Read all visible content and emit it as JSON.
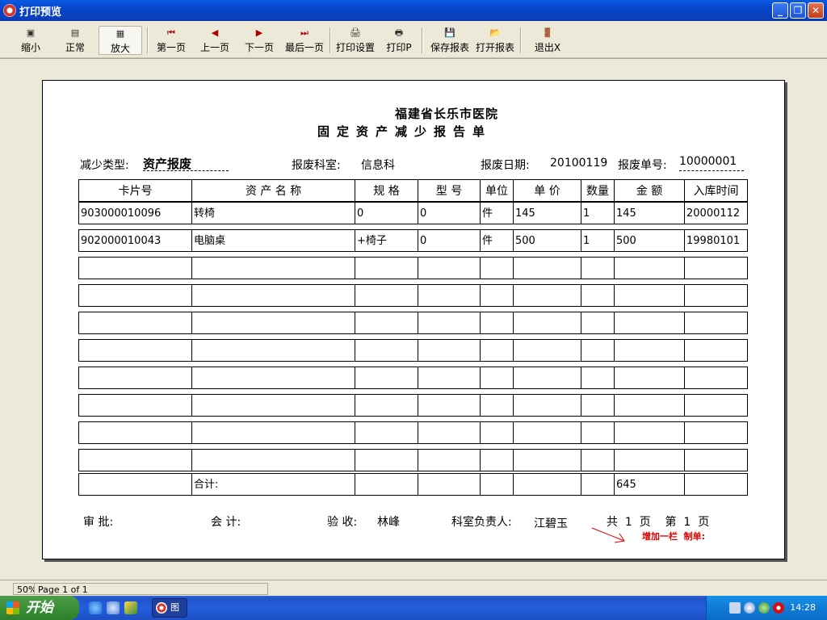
{
  "window": {
    "title": "打印预览",
    "controls": {
      "minimize": "_",
      "restore": "❐",
      "close": "✕"
    }
  },
  "toolbar": {
    "zoom_out": "缩小",
    "normal": "正常",
    "zoom_in": "放大",
    "first_page": "第一页",
    "prev_page": "上一页",
    "next_page": "下一页",
    "last_page": "最后一页",
    "print_setup": "打印设置",
    "print": "打印P",
    "save_report": "保存报表",
    "open_report": "打开报表",
    "exit": "退出X"
  },
  "report": {
    "org": "福建省长乐市医院",
    "title": "固定资产减少报告单",
    "reduce_type_label": "减少类型:",
    "reduce_type_value": "资产报废",
    "dept_label": "报废科室:",
    "dept_value": "信息科",
    "date_label": "报废日期:",
    "date_value": "20100119",
    "no_label": "报废单号:",
    "no_value": "10000001",
    "columns": [
      "卡片号",
      "资 产 名 称",
      "规  格",
      "型 号",
      "单位",
      "单 价",
      "数量",
      "金  额",
      "入库时间"
    ],
    "rows": [
      [
        "903000010096",
        "转椅",
        "0",
        "0",
        "件",
        "145",
        "1",
        "145",
        "20000112"
      ],
      [
        "902000010043",
        "电脑桌",
        "+椅子",
        "0",
        "件",
        "500",
        "1",
        "500",
        "19980101"
      ]
    ],
    "total_label": "合计:",
    "total_value": "645",
    "approve_label": "审  批:",
    "accountant_label": "会  计:",
    "acceptance_label": "验  收:",
    "acceptance_value": "林峰",
    "head_label": "科室负责人:",
    "head_value": "江碧玉",
    "page_info": "共  1  页    第  1  页",
    "annotation": "增加一栏  制单:"
  },
  "status": {
    "zoom": "50%",
    "page": "Page 1 of 1"
  },
  "taskbar": {
    "start": "开始",
    "task_label": "图",
    "clock": "14:28"
  }
}
